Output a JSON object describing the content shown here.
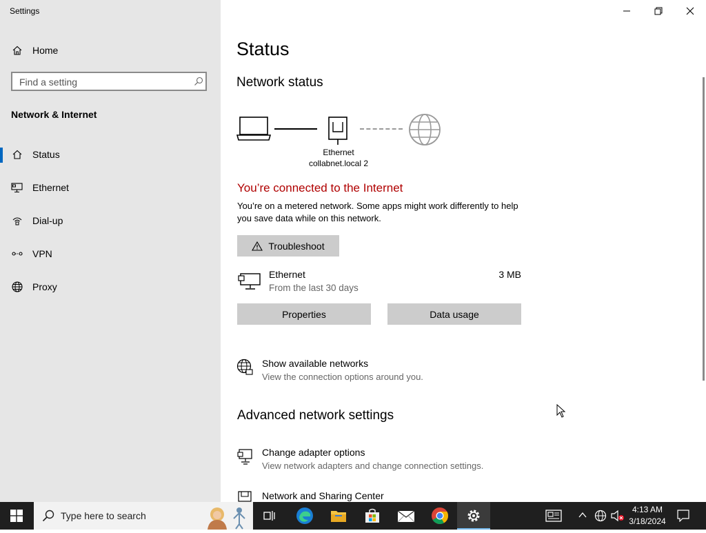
{
  "window": {
    "title": "Settings"
  },
  "sidebar": {
    "home_label": "Home",
    "search_placeholder": "Find a setting",
    "section_title": "Network & Internet",
    "items": [
      {
        "label": "Status",
        "icon": "home-status-icon",
        "active": true
      },
      {
        "label": "Ethernet",
        "icon": "ethernet-icon"
      },
      {
        "label": "Dial-up",
        "icon": "dialup-icon"
      },
      {
        "label": "VPN",
        "icon": "vpn-icon"
      },
      {
        "label": "Proxy",
        "icon": "globe-icon"
      }
    ]
  },
  "main": {
    "title": "Status",
    "network_status_heading": "Network status",
    "diagram": {
      "device_name": "Ethernet",
      "network_name": "collabnet.local 2"
    },
    "connected_text": "You’re connected to the Internet",
    "metered_text": "You’re on a metered network. Some apps might work differently to help you save data while on this network.",
    "troubleshoot_label": "Troubleshoot",
    "adapter": {
      "name": "Ethernet",
      "period": "From the last 30 days",
      "usage": "3 MB"
    },
    "properties_label": "Properties",
    "data_usage_label": "Data usage",
    "show_networks": {
      "title": "Show available networks",
      "subtitle": "View the connection options around you."
    },
    "advanced_heading": "Advanced network settings",
    "change_adapter": {
      "title": "Change adapter options",
      "subtitle": "View network adapters and change connection settings."
    },
    "sharing_center": {
      "title": "Network and Sharing Center"
    }
  },
  "taskbar": {
    "search_placeholder": "Type here to search",
    "time": "4:13 AM",
    "date": "3/18/2024"
  },
  "colors": {
    "accent": "#0067c0",
    "connected": "#b00000",
    "sidebar_bg": "#e6e6e6",
    "taskbar_bg": "#1f1f1f"
  }
}
